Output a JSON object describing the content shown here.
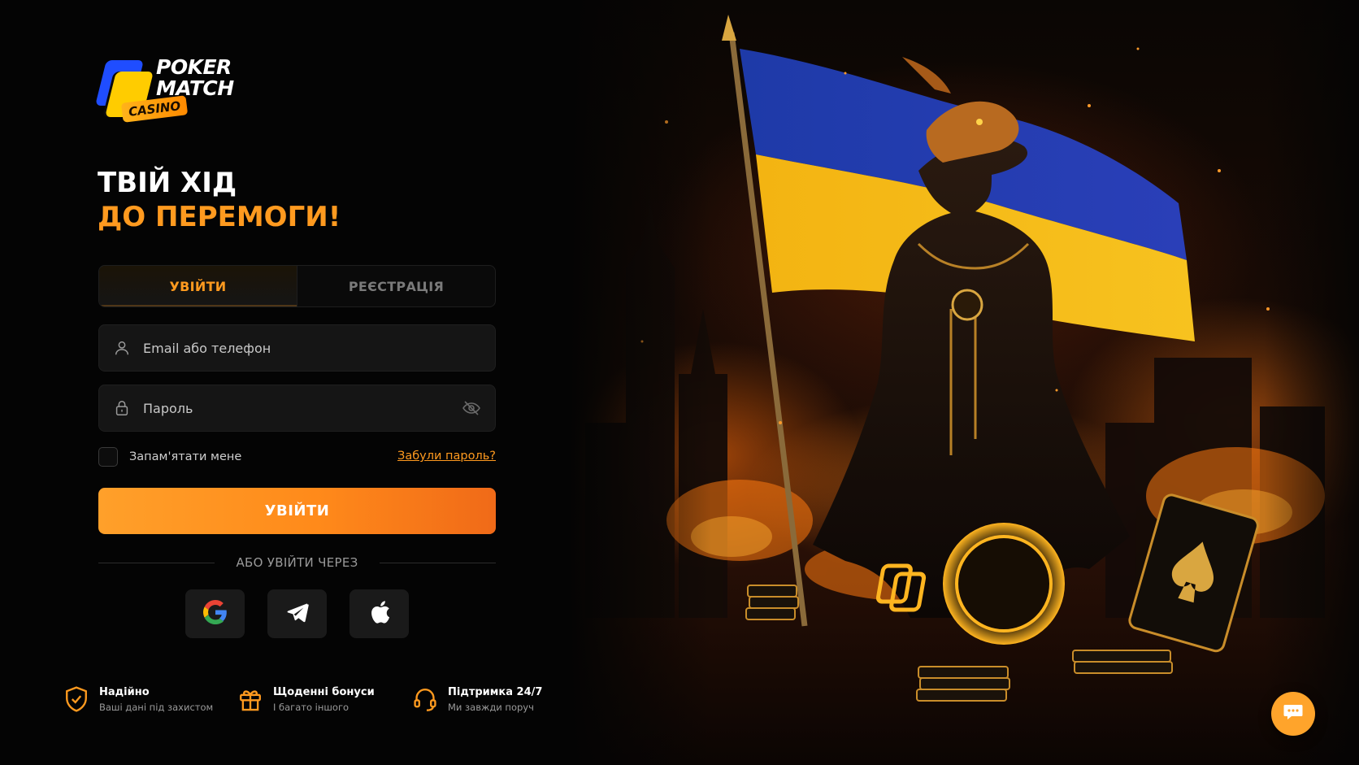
{
  "brand": {
    "line1": "POKER",
    "line2": "MATCH",
    "tag": "CASINO",
    "colors": {
      "blue": "#1f4dff",
      "yellow": "#ffcc00",
      "accent": "#ff9a1f"
    }
  },
  "headline": {
    "line1": "ТВІЙ ХІД",
    "line2": "ДО ПЕРЕМОГИ!"
  },
  "tabs": [
    {
      "label": "УВІЙТИ",
      "active": true
    },
    {
      "label": "РЕЄСТРАЦІЯ",
      "active": false
    }
  ],
  "form": {
    "email": {
      "placeholder": "Email або телефон",
      "value": "",
      "icon": "user-icon"
    },
    "password": {
      "placeholder": "Пароль",
      "value": "",
      "icon": "lock-icon",
      "toggle_icon": "eye-off-icon"
    },
    "remember_label": "Запам'ятати мене",
    "remember_checked": false,
    "forgot_label": "Забули пароль?",
    "submit_label": "УВІЙТИ"
  },
  "divider_text": "АБО УВІЙТИ ЧЕРЕЗ",
  "social": [
    {
      "name": "google",
      "icon": "google-icon"
    },
    {
      "name": "telegram",
      "icon": "telegram-icon"
    },
    {
      "name": "apple",
      "icon": "apple-icon"
    }
  ],
  "features": [
    {
      "title": "Надійно",
      "subtitle": "Ваші дані під захистом",
      "icon": "shield-check-icon"
    },
    {
      "title": "Щоденні бонуси",
      "subtitle": "І багато іншого",
      "icon": "gift-icon"
    },
    {
      "title": "Підтримка 24/7",
      "subtitle": "Ми завжди поруч",
      "icon": "headset-icon"
    }
  ],
  "chat": {
    "icon": "chat-bubble-icon"
  }
}
